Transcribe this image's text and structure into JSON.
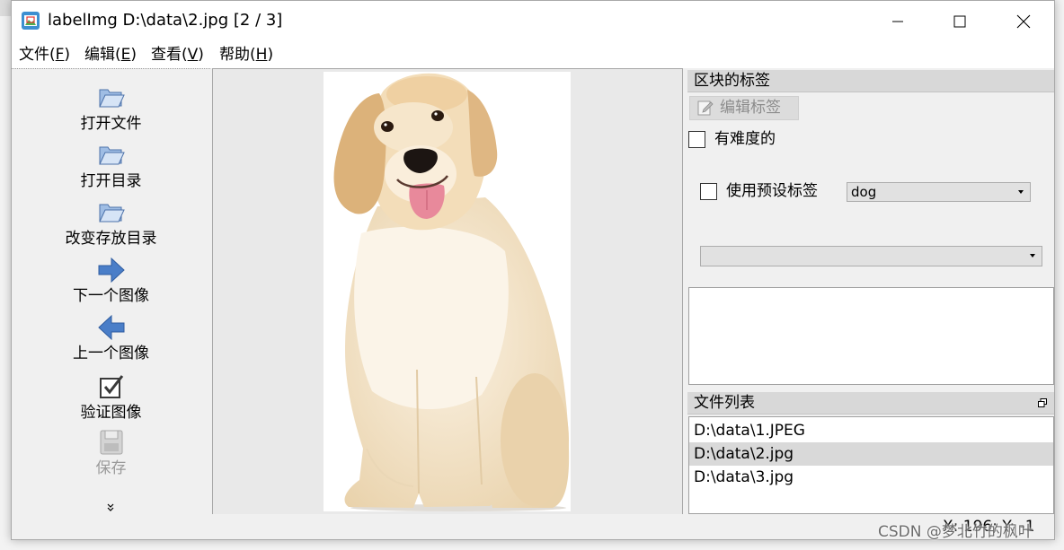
{
  "window": {
    "title": "labelImg D:\\data\\2.jpg [2 / 3]",
    "app_icon": "labelimg-app-icon",
    "controls": [
      "minimize-icon",
      "maximize-icon",
      "close-icon"
    ]
  },
  "menu": [
    {
      "before": "文件(",
      "key": "F",
      "after": ")"
    },
    {
      "before": "编辑(",
      "key": "E",
      "after": ")"
    },
    {
      "before": "查看(",
      "key": "V",
      "after": ")"
    },
    {
      "before": "帮助(",
      "key": "H",
      "after": ")"
    }
  ],
  "toolbar": {
    "items": [
      {
        "label": "打开文件",
        "icon": "open-folder-icon",
        "enabled": true
      },
      {
        "label": "打开目录",
        "icon": "open-folder-icon",
        "enabled": true
      },
      {
        "label": "改变存放目录",
        "icon": "open-folder-icon",
        "enabled": true
      },
      {
        "label": "下一个图像",
        "icon": "arrow-right-icon",
        "enabled": true
      },
      {
        "label": "上一个图像",
        "icon": "arrow-left-icon",
        "enabled": true
      },
      {
        "label": "验证图像",
        "icon": "verify-checkbox-icon",
        "enabled": true
      },
      {
        "label": "保存",
        "icon": "save-floppy-icon",
        "enabled": false
      }
    ],
    "more_icon": "chevron-double-down-icon"
  },
  "labels_dock": {
    "title": "区块的标签",
    "edit_button": {
      "label": "编辑标签",
      "icon": "pencil-edit-icon",
      "enabled": false
    },
    "difficult": {
      "label": "有难度的",
      "checked": false
    },
    "use_default": {
      "label": "使用预设标签",
      "checked": false
    },
    "default_label_value": "dog",
    "label_combo_value": "",
    "label_list": []
  },
  "file_dock": {
    "title": "文件列表",
    "float_icon": "dock-float-icon",
    "files": [
      "D:\\data\\1.JPEG",
      "D:\\data\\2.jpg",
      "D:\\data\\3.jpg"
    ],
    "selected_index": 1
  },
  "status": {
    "coords": "X: 196; Y: -1"
  },
  "watermark": "CSDN @梦北竹的枫叶",
  "colors": {
    "selection_bg": "#d9d9d9",
    "dock_title_bg": "#d8d8d8",
    "canvas_bg": "#e9e9e9",
    "arrow_blue": "#4a7ec8",
    "disabled_text": "#9a9a9a"
  }
}
